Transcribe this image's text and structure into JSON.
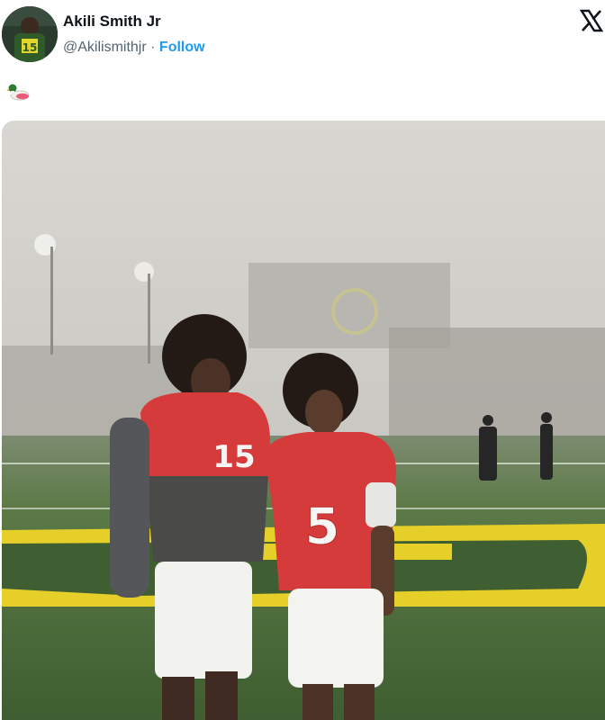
{
  "tweet": {
    "author_name": "Akili Smith Jr",
    "handle": "@Akilismithjr",
    "separator": "·",
    "follow_label": "Follow",
    "body_emoji": "duck-emoji",
    "platform_icon": "x-logo-icon"
  },
  "photo": {
    "jersey_numbers": [
      "15",
      "5"
    ],
    "colors": {
      "fog": "#cfcdc7",
      "field": "#4b6a3a",
      "end_zone_yellow": "#e8d22a",
      "jersey_red": "#d63b3b"
    }
  }
}
